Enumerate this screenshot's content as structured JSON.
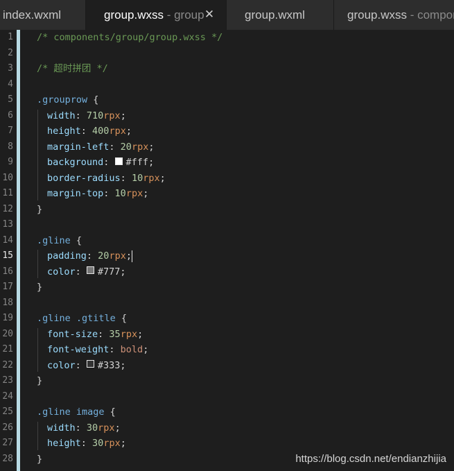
{
  "tabs": [
    {
      "label": "index.wxml",
      "sub": "",
      "active": false,
      "close": false
    },
    {
      "label": "group.wxss",
      "sub": " - group",
      "active": true,
      "close": true
    },
    {
      "label": "group.wxml",
      "sub": "",
      "active": false,
      "close": false
    },
    {
      "label": "group.wxss",
      "sub": " - compon",
      "active": false,
      "close": false
    }
  ],
  "close_glyph": "✕",
  "current_line": 15,
  "line_numbers": [
    "1",
    "2",
    "3",
    "4",
    "5",
    "6",
    "7",
    "8",
    "9",
    "10",
    "11",
    "12",
    "13",
    "14",
    "15",
    "16",
    "17",
    "18",
    "19",
    "20",
    "21",
    "22",
    "23",
    "24",
    "25",
    "26",
    "27",
    "28"
  ],
  "lines": [
    [
      {
        "t": "/* components/group/group.wxss */",
        "c": "cmt"
      }
    ],
    [],
    [
      {
        "t": "/* 超时拼团 */",
        "c": "cmt"
      }
    ],
    [],
    [
      {
        "t": ".grouprow",
        "c": "sel"
      },
      {
        "t": " {",
        "c": "punc"
      }
    ],
    [
      {
        "t": "width",
        "c": "prop"
      },
      {
        "t": ": ",
        "c": "punc"
      },
      {
        "t": "710",
        "c": "num"
      },
      {
        "t": "rpx",
        "c": "unit"
      },
      {
        "t": ";",
        "c": "punc"
      }
    ],
    [
      {
        "t": "height",
        "c": "prop"
      },
      {
        "t": ": ",
        "c": "punc"
      },
      {
        "t": "400",
        "c": "num"
      },
      {
        "t": "rpx",
        "c": "unit"
      },
      {
        "t": ";",
        "c": "punc"
      }
    ],
    [
      {
        "t": "margin-left",
        "c": "prop"
      },
      {
        "t": ": ",
        "c": "punc"
      },
      {
        "t": "20",
        "c": "num"
      },
      {
        "t": "rpx",
        "c": "unit"
      },
      {
        "t": ";",
        "c": "punc"
      }
    ],
    [
      {
        "t": "background",
        "c": "prop"
      },
      {
        "t": ": ",
        "c": "punc"
      },
      {
        "swatch": "#ffffff"
      },
      {
        "t": "#fff",
        "c": "val"
      },
      {
        "t": ";",
        "c": "punc"
      }
    ],
    [
      {
        "t": "border-radius",
        "c": "prop"
      },
      {
        "t": ": ",
        "c": "punc"
      },
      {
        "t": "10",
        "c": "num"
      },
      {
        "t": "rpx",
        "c": "unit"
      },
      {
        "t": ";",
        "c": "punc"
      }
    ],
    [
      {
        "t": "margin-top",
        "c": "prop"
      },
      {
        "t": ": ",
        "c": "punc"
      },
      {
        "t": "10",
        "c": "num"
      },
      {
        "t": "rpx",
        "c": "unit"
      },
      {
        "t": ";",
        "c": "punc"
      }
    ],
    [
      {
        "t": "}",
        "c": "punc"
      }
    ],
    [],
    [
      {
        "t": ".gline",
        "c": "sel"
      },
      {
        "t": " {",
        "c": "punc"
      }
    ],
    [
      {
        "t": "padding",
        "c": "prop"
      },
      {
        "t": ": ",
        "c": "punc"
      },
      {
        "t": "20",
        "c": "num"
      },
      {
        "t": "rpx",
        "c": "unit"
      },
      {
        "t": ";",
        "c": "punc"
      },
      {
        "cursor": true
      }
    ],
    [
      {
        "t": "color",
        "c": "prop"
      },
      {
        "t": ": ",
        "c": "punc"
      },
      {
        "swatch": "#777777"
      },
      {
        "t": "#777",
        "c": "val"
      },
      {
        "t": ";",
        "c": "punc"
      }
    ],
    [
      {
        "t": "}",
        "c": "punc"
      }
    ],
    [],
    [
      {
        "t": ".gline .gtitle",
        "c": "sel"
      },
      {
        "t": " {",
        "c": "punc"
      }
    ],
    [
      {
        "t": "font-size",
        "c": "prop"
      },
      {
        "t": ": ",
        "c": "punc"
      },
      {
        "t": "35",
        "c": "num"
      },
      {
        "t": "rpx",
        "c": "unit"
      },
      {
        "t": ";",
        "c": "punc"
      }
    ],
    [
      {
        "t": "font-weight",
        "c": "prop"
      },
      {
        "t": ": ",
        "c": "punc"
      },
      {
        "t": "bold",
        "c": "kw"
      },
      {
        "t": ";",
        "c": "punc"
      }
    ],
    [
      {
        "t": "color",
        "c": "prop"
      },
      {
        "t": ": ",
        "c": "punc"
      },
      {
        "swatch": "#333333"
      },
      {
        "t": "#333",
        "c": "val"
      },
      {
        "t": ";",
        "c": "punc"
      }
    ],
    [
      {
        "t": "}",
        "c": "punc"
      }
    ],
    [],
    [
      {
        "t": ".gline image",
        "c": "sel"
      },
      {
        "t": " {",
        "c": "punc"
      }
    ],
    [
      {
        "t": "width",
        "c": "prop"
      },
      {
        "t": ": ",
        "c": "punc"
      },
      {
        "t": "30",
        "c": "num"
      },
      {
        "t": "rpx",
        "c": "unit"
      },
      {
        "t": ";",
        "c": "punc"
      }
    ],
    [
      {
        "t": "height",
        "c": "prop"
      },
      {
        "t": ": ",
        "c": "punc"
      },
      {
        "t": "30",
        "c": "num"
      },
      {
        "t": "rpx",
        "c": "unit"
      },
      {
        "t": ";",
        "c": "punc"
      }
    ],
    [
      {
        "t": "}",
        "c": "punc"
      }
    ]
  ],
  "watermark": "https://blog.csdn.net/endianzhijia",
  "colors": {
    "editor_background": "#1e1e1e",
    "gutter_stripe": "#b9dbe4",
    "comment": "#6a9955",
    "selector": "#74b0dd",
    "property": "#9cdcfe",
    "number": "#b5cea8",
    "unit": "#d8925b"
  }
}
